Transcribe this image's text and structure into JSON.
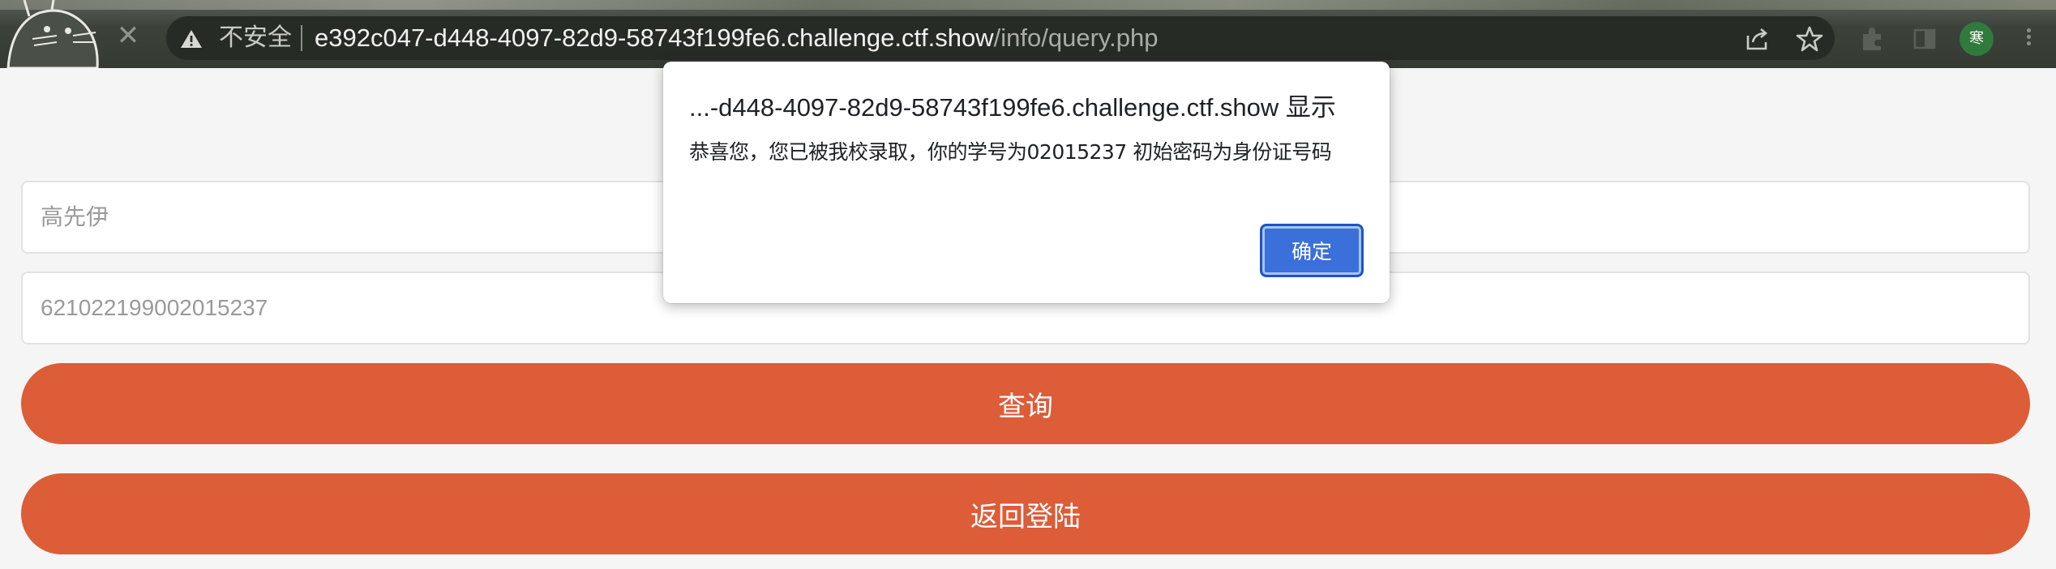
{
  "browser": {
    "security_label": "不安全",
    "url_host": "e392c047-d448-4097-82d9-58743f199fe6.challenge.ctf.show",
    "url_path": "/info/query.php",
    "profile_initial": "寒"
  },
  "form": {
    "name_value": "高先伊",
    "id_value": "621022199002015237",
    "query_button": "查询",
    "back_button": "返回登陆"
  },
  "dialog": {
    "title": "...-d448-4097-82d9-58743f199fe6.challenge.ctf.show 显示",
    "message": "恭喜您，您已被我校录取，你的学号为02015237 初始密码为身份证号码",
    "ok_button": "确定"
  },
  "colors": {
    "accent_button": "#dc5d38",
    "dialog_button": "#3b6fd9",
    "profile_avatar": "#2f7a3c"
  }
}
